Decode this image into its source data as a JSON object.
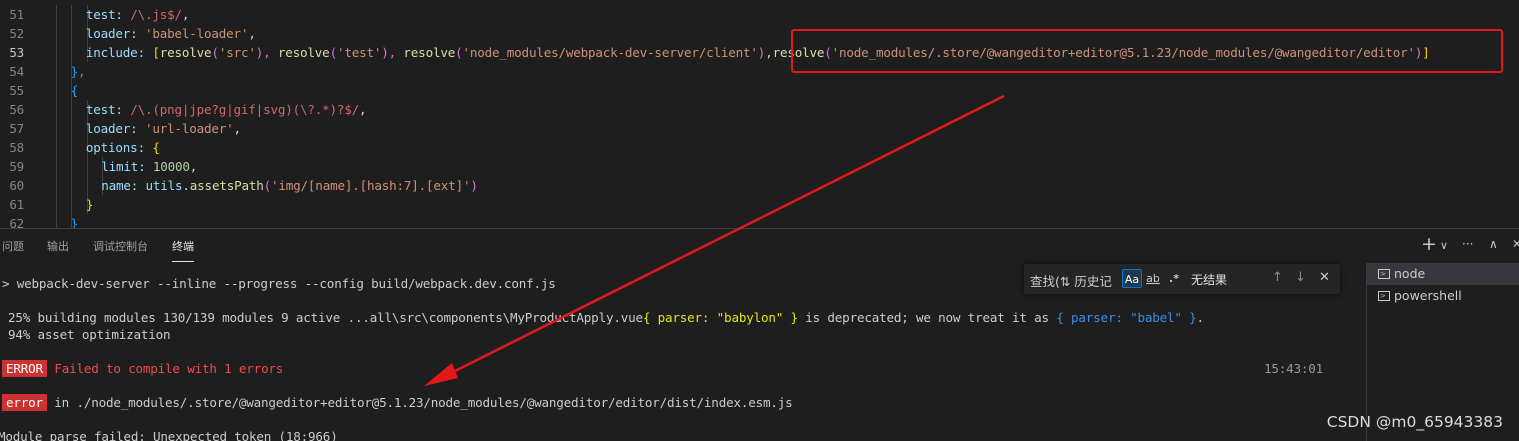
{
  "editor": {
    "lines": [
      {
        "n": "51",
        "active": false,
        "indent": 3,
        "tokens": [
          [
            "test: ",
            "prop"
          ],
          [
            "/\\.js$/",
            "re"
          ],
          [
            ",",
            "plain"
          ]
        ]
      },
      {
        "n": "52",
        "active": false,
        "indent": 3,
        "tokens": [
          [
            "loader: ",
            "prop"
          ],
          [
            "'babel-loader'",
            "str"
          ],
          [
            ",",
            "plain"
          ]
        ]
      },
      {
        "n": "53",
        "active": true,
        "indent": 3,
        "tokens": [
          [
            "include: ",
            "prop"
          ],
          [
            "[",
            "p1"
          ],
          [
            "resolve",
            "fn"
          ],
          [
            "(",
            "p2"
          ],
          [
            "'src'",
            "str"
          ],
          [
            "), ",
            "p2"
          ],
          [
            "resolve",
            "fn"
          ],
          [
            "(",
            "p2"
          ],
          [
            "'test'",
            "str"
          ],
          [
            "), ",
            "p2"
          ],
          [
            "resolve",
            "fn"
          ],
          [
            "(",
            "p2"
          ],
          [
            "'node_modules/webpack-dev-server/client'",
            "str"
          ],
          [
            ")",
            "p2"
          ],
          [
            ",",
            "plain"
          ],
          [
            "resolve",
            "fn"
          ],
          [
            "(",
            "p2"
          ],
          [
            "'node_modules/.store/@wangeditor+editor@5.1.23/node_modules/@wangeditor/editor'",
            "str"
          ],
          [
            ")",
            "p2"
          ],
          [
            "]",
            "p1"
          ]
        ]
      },
      {
        "n": "54",
        "active": false,
        "indent": 2,
        "tokens": [
          [
            "},",
            "p3"
          ]
        ]
      },
      {
        "n": "55",
        "active": false,
        "indent": 2,
        "tokens": [
          [
            "{",
            "p3"
          ]
        ]
      },
      {
        "n": "56",
        "active": false,
        "indent": 3,
        "tokens": [
          [
            "test: ",
            "prop"
          ],
          [
            "/\\.(png|jpe?g|gif|svg)(\\?.*)?$/",
            "re"
          ],
          [
            ",",
            "plain"
          ]
        ]
      },
      {
        "n": "57",
        "active": false,
        "indent": 3,
        "tokens": [
          [
            "loader: ",
            "prop"
          ],
          [
            "'url-loader'",
            "str"
          ],
          [
            ",",
            "plain"
          ]
        ]
      },
      {
        "n": "58",
        "active": false,
        "indent": 3,
        "tokens": [
          [
            "options: ",
            "prop"
          ],
          [
            "{",
            "p1"
          ]
        ]
      },
      {
        "n": "59",
        "active": false,
        "indent": 4,
        "tokens": [
          [
            "limit: ",
            "prop"
          ],
          [
            "10000",
            "num"
          ],
          [
            ",",
            "plain"
          ]
        ]
      },
      {
        "n": "60",
        "active": false,
        "indent": 4,
        "tokens": [
          [
            "name: ",
            "prop"
          ],
          [
            "utils",
            "var"
          ],
          [
            ".",
            "plain"
          ],
          [
            "assetsPath",
            "fn"
          ],
          [
            "(",
            "p2"
          ],
          [
            "'img/[name].[hash:7].[ext]'",
            "str"
          ],
          [
            ")",
            "p2"
          ]
        ]
      },
      {
        "n": "61",
        "active": false,
        "indent": 3,
        "tokens": [
          [
            "}",
            "p1"
          ]
        ]
      },
      {
        "n": "62",
        "active": false,
        "indent": 2,
        "tokens": [
          [
            "}",
            "p3"
          ]
        ]
      }
    ]
  },
  "panel": {
    "tabs": [
      "问题",
      "输出",
      "调试控制台",
      "终端"
    ],
    "active_tab": "终端",
    "icons": {
      "add": "+",
      "dropdown": "∨",
      "more": "···",
      "collapse": "∧",
      "close": "✕"
    }
  },
  "terminal": {
    "command": "> webpack-dev-server --inline --progress --config build/webpack.dev.conf.js",
    "progress_pre": "25% building modules 130/139 modules 9 active ...all\\src\\components\\MyProductApply.vue",
    "progress_yellow1": "{ parser: \"babylon\" }",
    "progress_mid": " is deprecated; we now treat it as ",
    "progress_yellow2": "{ parser: \"babel\" }",
    "progress_end": ".",
    "asset": "94% asset optimization",
    "error_badge": "ERROR",
    "error_msg": "Failed to compile with 1 errors",
    "error_time": "15:43:01",
    "error2_badge": "error",
    "error2_msg": " in ./node_modules/.store/@wangeditor+editor@5.1.23/node_modules/@wangeditor/editor/dist/index.esm.js",
    "parse_fail": "Module parse failed: Unexpected token (18:966)"
  },
  "find_widget": {
    "input": "查找(⇅ 历史记",
    "opt_case": "Aa",
    "opt_word": "ab",
    "opt_regex": ".*",
    "result": "无结果",
    "prev": "↑",
    "next": "↓",
    "close": "✕"
  },
  "terminal_list": [
    {
      "label": "node",
      "selected": true
    },
    {
      "label": "powershell",
      "selected": false
    }
  ],
  "watermark": "CSDN @m0_65943383"
}
